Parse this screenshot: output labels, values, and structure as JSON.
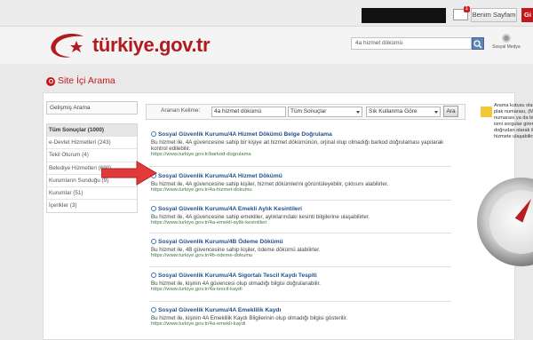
{
  "topbar": {
    "mail_badge": "1",
    "mypage_label": "Benim Sayfam",
    "login_label": "Gi"
  },
  "header": {
    "logo_text": "türkiye.gov.tr",
    "search_value": "4a hizmet dökümü",
    "social_label": "Sosyal Medya"
  },
  "page": {
    "title": "Site İçi Arama"
  },
  "sidebar": {
    "advanced_label": "Gelişmiş Arama",
    "items": [
      {
        "label": "Tüm Sonuçlar (1000)",
        "active": true
      },
      {
        "label": "e-Devlet Hizmetleri (243)"
      },
      {
        "label": "Tekil Oturum (4)"
      },
      {
        "label": "Belediye Hizmetleri (690)"
      },
      {
        "label": "Kurumların Sunduğu (9)"
      },
      {
        "label": "Kurumlar (51)"
      },
      {
        "label": "İçerikler (3)"
      }
    ]
  },
  "search_form": {
    "label": "Aranan Kelime:",
    "value": "4a hizmet dökümü",
    "filter_value": "Tüm Sonuçlar",
    "sort_value": "Sık Kullanma Göre",
    "button_label": "Ara"
  },
  "results": [
    {
      "title": "Sosyal Güvenlik Kurumu/4A Hizmet Dökümü Belge Doğrulama",
      "desc": "Bu hizmet ile, 4A güvencesine sahip bir kişiye ait hizmet dökümünün, orjinal olup olmadığı barkod doğrulaması yapılarak kontrol edilebilir.",
      "url": "https://www.turkiye.gov.tr/barkod-dogrulama"
    },
    {
      "title": "Sosyal Güvenlik Kurumu/4A Hizmet Dökümü",
      "desc": "Bu hizmet ile, 4A güvencesine sahip kişiler, hizmet dökümlerini görüntüleyebilir, çıktısını alabilirler.",
      "url": "https://www.turkiye.gov.tr/4a-hizmet-dokumu"
    },
    {
      "title": "Sosyal Güvenlik Kurumu/4A Emekli Aylık Kesintileri",
      "desc": "Bu hizmet ile, 4A güvencesine sahip emekliler, aylıklarındaki kesinti bilgilerine ulaşabilirler.",
      "url": "https://www.turkiye.gov.tr/4a-emekli-aylik-kesintileri"
    },
    {
      "title": "Sosyal Güvenlik Kurumu/4B Ödeme Dökümü",
      "desc": "Bu hizmet ile, 4B güvencesine sahip kişiler, ödeme dökümü alabilirler.",
      "url": "https://www.turkiye.gov.tr/4b-odeme-dokumu"
    },
    {
      "title": "Sosyal Güvenlik Kurumu/4A Sigortalı Tescil Kaydı Tespiti",
      "desc": "Bu hizmet ile, kişinin 4A güvencesi olup olmadığı bilgisi doğrulanabilir.",
      "url": "https://www.turkiye.gov.tr/4a-tescil-kaydi"
    },
    {
      "title": "Sosyal Güvenlik Kurumu/4A Emeklilik Kaydı",
      "desc": "Bu hizmet ile, kişinin 4A Emeklilik Kaydı Bilgilerinin olup olmadığı bilgisi gösterilir.",
      "url": "https://www.turkiye.gov.tr/4a-emekli-kaydi"
    }
  ],
  "promo": {
    "text": "Arama kutusu olarak bir plak numarası, (ME) numarası ya da bir şehir ismi sorgular girerek, doğrudan olarak ilgili hizmete ulaşabilirsiniz."
  },
  "colors": {
    "brand_red": "#b11a1f",
    "link_blue": "#264f8c",
    "url_green": "#3c7a3c"
  }
}
